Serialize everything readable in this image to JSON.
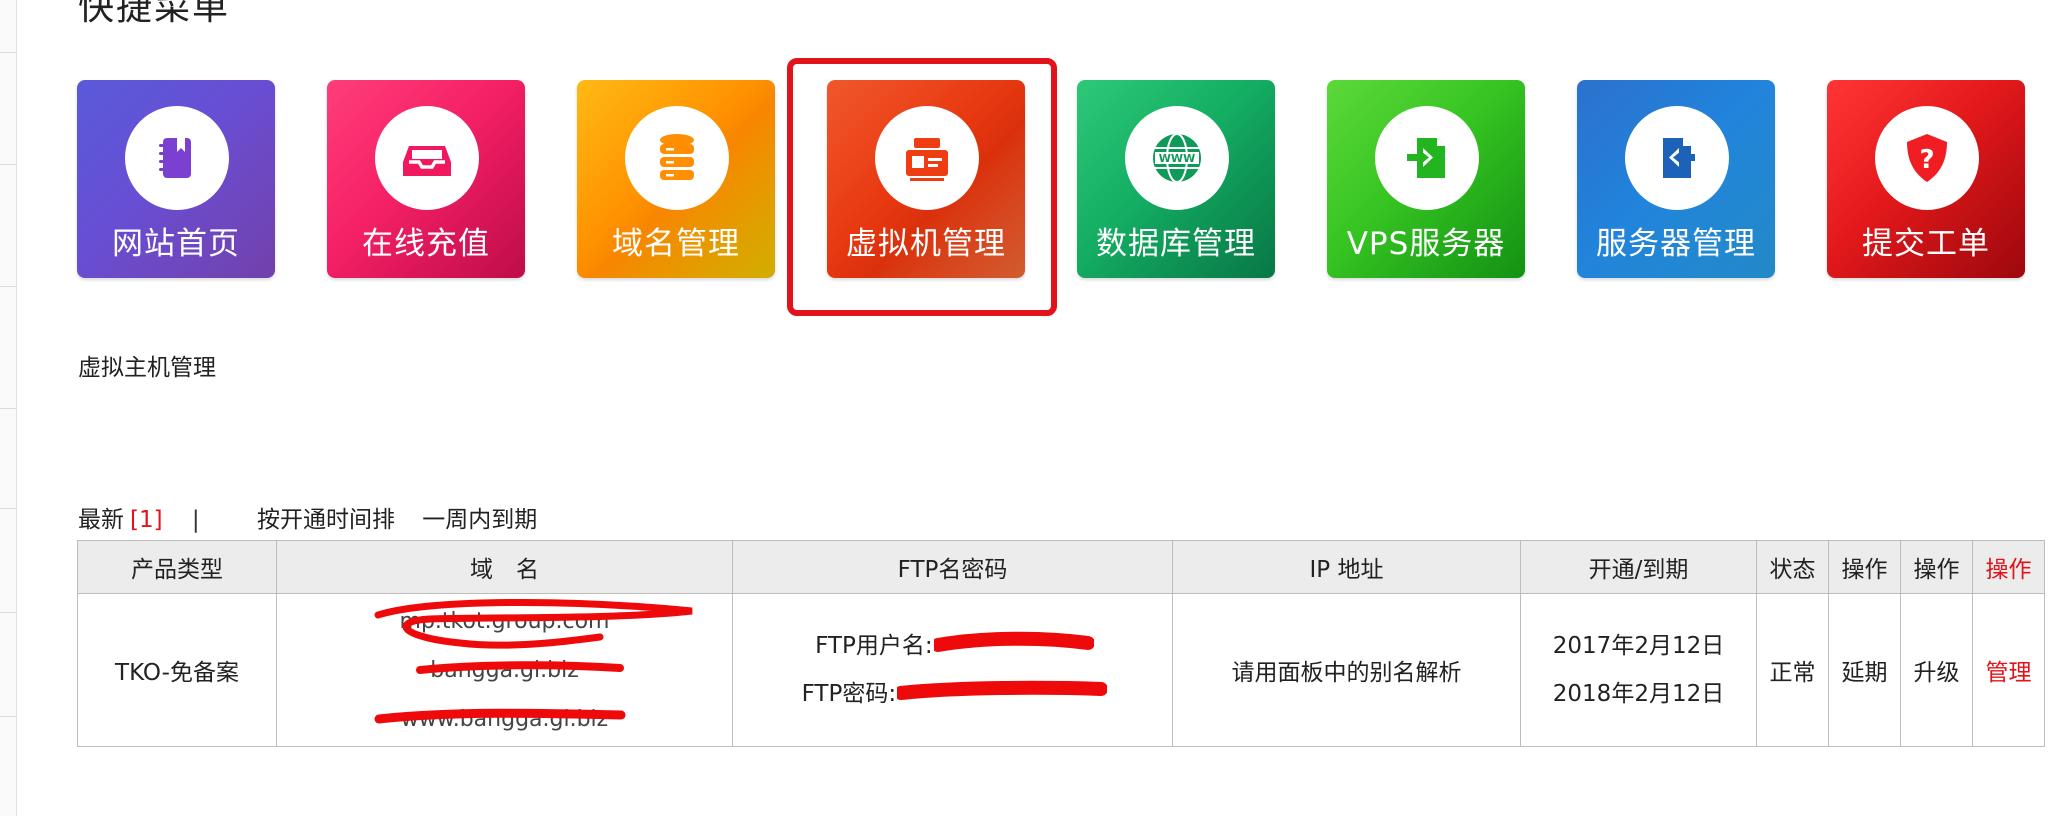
{
  "section_title": "快捷菜单",
  "tiles": [
    {
      "label": "网站首页",
      "icon": "notebook-icon",
      "color_a": "#4c4dd6",
      "color_b": "#8a4fd0"
    },
    {
      "label": "在线充值",
      "icon": "inbox-icon",
      "color_a": "#ff2d6f",
      "color_b": "#e8105a"
    },
    {
      "label": "域名管理",
      "icon": "database-icon",
      "color_a": "#ffd000",
      "color_b": "#ff8f00"
    },
    {
      "label": "虚拟机管理",
      "icon": "server-card-icon",
      "color_a": "#ff6a2a",
      "color_b": "#e8350e"
    },
    {
      "label": "数据库管理",
      "icon": "www-globe-icon",
      "color_a": "#1bbf6a",
      "color_b": "#0a9256"
    },
    {
      "label": "VPS服务器",
      "icon": "file-enter-icon",
      "color_a": "#4fd52a",
      "color_b": "#1db41d"
    },
    {
      "label": "服务器管理",
      "icon": "file-exit-icon",
      "color_a": "#2fa8f5",
      "color_b": "#1570d0"
    },
    {
      "label": "提交工单",
      "icon": "shield-question-icon",
      "color_a": "#ff1f22",
      "color_b": "#c50b12"
    }
  ],
  "sub_heading": "虚拟主机管理",
  "filters": {
    "latest": "最新",
    "count": "[1]",
    "separator": "|",
    "by_open_time": "按开通时间排",
    "expiring_week": "一周内到期"
  },
  "table": {
    "headers": [
      "产品类型",
      "域　名",
      "FTP名密码",
      "IP 地址",
      "开通/到期",
      "状态",
      "操作",
      "操作",
      "操作"
    ],
    "row": {
      "product": "TKO-免备案",
      "domains": [
        "mp.tkot.group.com",
        "bangga.gi.biz",
        "www.bangga.gi.biz"
      ],
      "ftp_user_label": "FTP用户名:",
      "ftp_pass_label": "FTP密码:",
      "ip": "请用面板中的别名解析",
      "open_date": "2017年2月12日",
      "expire_date": "2018年2月12日",
      "status": "正常",
      "action_extend": "延期",
      "action_upgrade": "升级",
      "action_manage": "管理"
    }
  },
  "colors": {
    "accent_red": "#e0141a",
    "header_bg": "#ececec",
    "border": "#bdbdbd"
  }
}
